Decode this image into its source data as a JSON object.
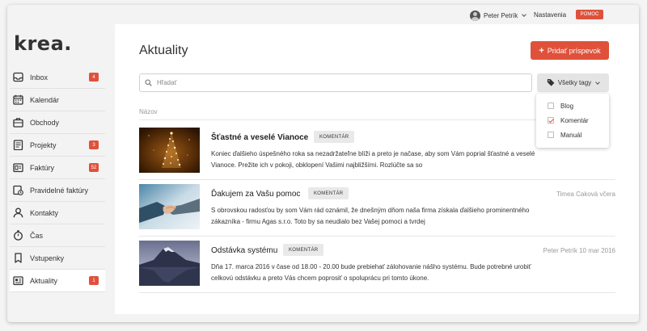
{
  "topbar": {
    "user_name": "Peter Petrík",
    "settings_label": "Nastavenia",
    "help_label": "POMOC"
  },
  "sidebar": {
    "logo": "krea.",
    "items": [
      {
        "label": "Inbox",
        "icon": "inbox-icon",
        "badge": "4"
      },
      {
        "label": "Kalendár",
        "icon": "calendar-icon",
        "badge": ""
      },
      {
        "label": "Obchody",
        "icon": "briefcase-icon",
        "badge": ""
      },
      {
        "label": "Projekty",
        "icon": "projects-icon",
        "badge": "3"
      },
      {
        "label": "Faktúry",
        "icon": "invoice-icon",
        "badge": "52"
      },
      {
        "label": "Pravidelné faktúry",
        "icon": "recurring-invoice-icon",
        "badge": ""
      },
      {
        "label": "Kontakty",
        "icon": "contact-icon",
        "badge": ""
      },
      {
        "label": "Čas",
        "icon": "stopwatch-icon",
        "badge": ""
      },
      {
        "label": "Vstupenky",
        "icon": "ticket-icon",
        "badge": ""
      },
      {
        "label": "Aktuality",
        "icon": "news-icon",
        "badge": "1",
        "active": true
      }
    ]
  },
  "main": {
    "title": "Aktuality",
    "add_button": "Pridať príspevok",
    "search_placeholder": "Hľadať",
    "tags_button": "Všetky tagy",
    "column_header": "Názov",
    "tag_options": [
      {
        "label": "Blog",
        "checked": false
      },
      {
        "label": "Komentár",
        "checked": true
      },
      {
        "label": "Manuál",
        "checked": false
      }
    ],
    "posts": [
      {
        "title": "Šťastné a veselé Vianoce",
        "tag": "KOMENTÁR",
        "meta": "",
        "excerpt": "Koniec ďalšieho úspešného roka sa nezadržateľne blíži a preto je načase, aby som Vám poprial šťastné a veselé Vianoce. Prežite ich v pokoji, obklopení Vašimi najbližšími. Rozlúčte sa so"
      },
      {
        "title": "Ďakujem za Vašu pomoc",
        "tag": "KOMENTÁR",
        "meta": "Timea Caková včera",
        "excerpt": "S obrovskou radosťou by som Vám rád oznámil, že dnešným dňom naša firma získala ďalšieho prominentného zákazníka - firmu Agas s.r.o. Toto by sa neudialo bez Vašej pomoci a tvrdej"
      },
      {
        "title": "Odstávka systému",
        "tag": "KOMENTÁR",
        "meta": "Peter Petrík 10 mar 2016",
        "excerpt": "Dňa 17. marca 2016 v čase od 18.00 - 20.00 bude prebiehať zálohovanie nášho systému. Bude potrebné urobiť celkovú odstávku a preto Vás chcem poprosiť o spoluprácu pri tomto úkone."
      }
    ]
  },
  "colors": {
    "accent": "#e0513b",
    "badge": "#e0513b",
    "sidebar_bg": "#f3f3f3",
    "content_bg": "#ffffff"
  }
}
